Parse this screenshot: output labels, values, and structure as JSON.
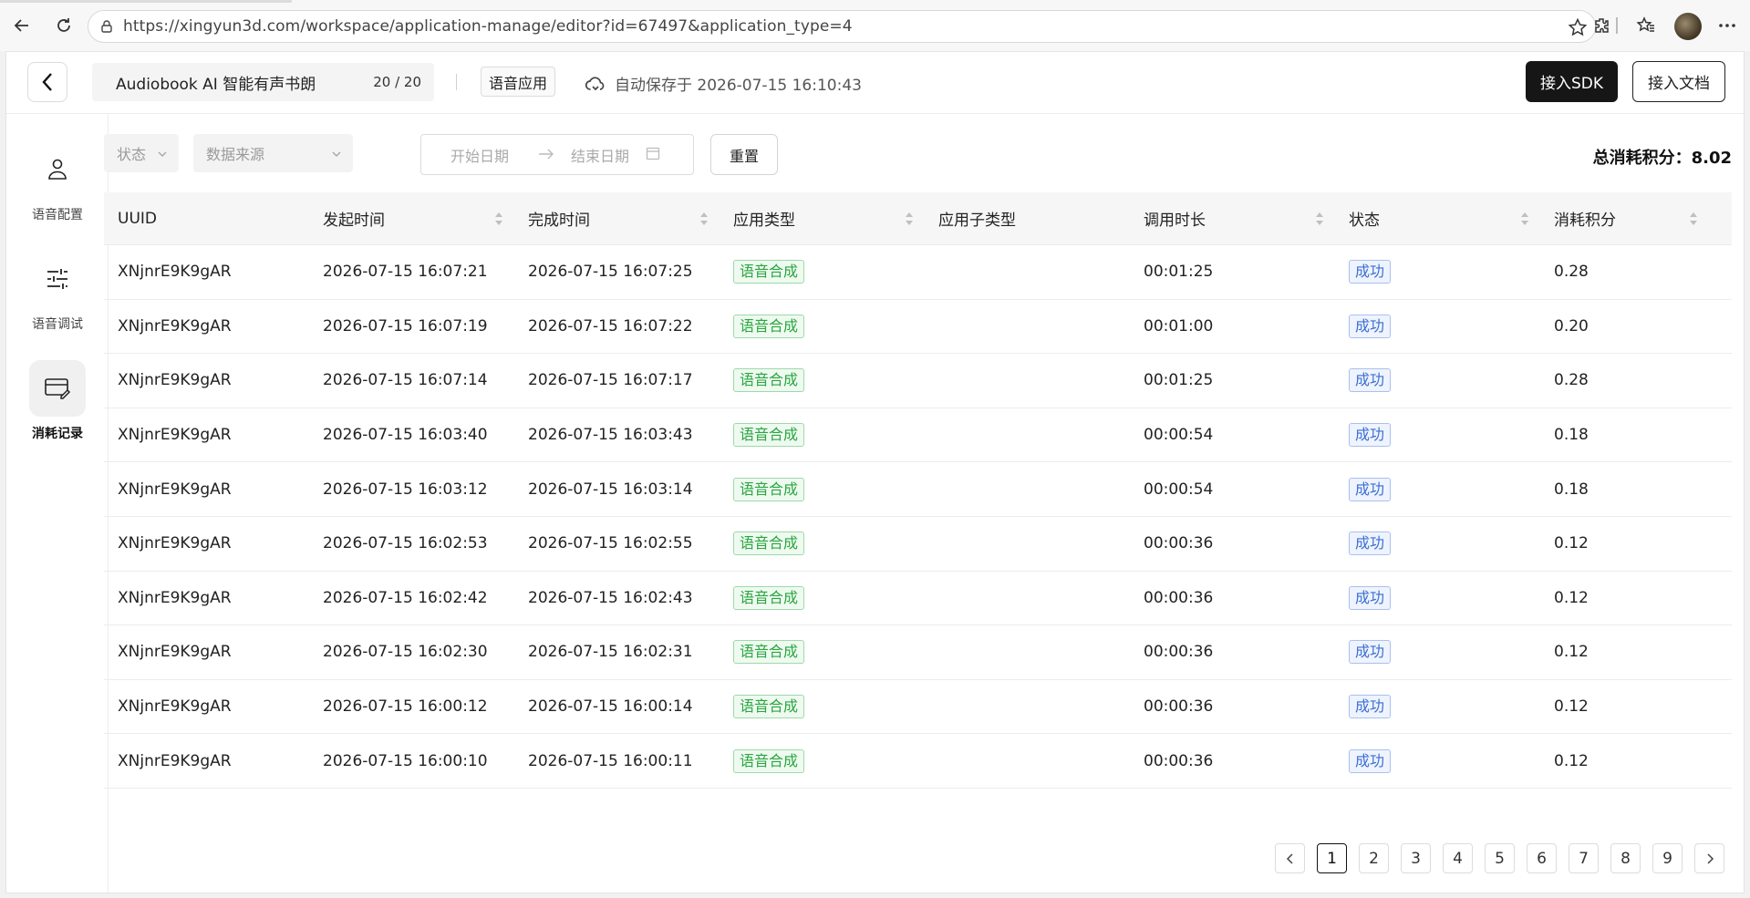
{
  "browser": {
    "url": "https://xingyun3d.com/workspace/application-manage/editor?id=67497&application_type=4"
  },
  "header": {
    "app_title": "Audiobook AI 智能有声书朗",
    "title_count": "20 / 20",
    "app_type": "语音应用",
    "autosave": "自动保存于 2026-07-15 16:10:43",
    "sdk_label": "接入SDK",
    "doc_label": "接入文档"
  },
  "sidebar": {
    "items": [
      {
        "label": "语音配置",
        "icon": "user-icon"
      },
      {
        "label": "语音调试",
        "icon": "sliders-icon"
      },
      {
        "label": "消耗记录",
        "icon": "card-edit-icon"
      }
    ]
  },
  "filters": {
    "status": "状态",
    "source": "数据来源",
    "start_date": "开始日期",
    "end_date": "结束日期",
    "reset": "重置"
  },
  "summary": {
    "total_points": "总消耗积分：8.02"
  },
  "table": {
    "headers": [
      "UUID",
      "发起时间",
      "完成时间",
      "应用类型",
      "应用子类型",
      "调用时长",
      "状态",
      "消耗积分"
    ],
    "rows": [
      {
        "uuid": "XNjnrE9K9gAR",
        "start": "2026-07-15 16:07:21",
        "end": "2026-07-15 16:07:25",
        "type": "语音合成",
        "subtype": "",
        "duration": "00:01:25",
        "status": "成功",
        "points": "0.28"
      },
      {
        "uuid": "XNjnrE9K9gAR",
        "start": "2026-07-15 16:07:19",
        "end": "2026-07-15 16:07:22",
        "type": "语音合成",
        "subtype": "",
        "duration": "00:01:00",
        "status": "成功",
        "points": "0.20"
      },
      {
        "uuid": "XNjnrE9K9gAR",
        "start": "2026-07-15 16:07:14",
        "end": "2026-07-15 16:07:17",
        "type": "语音合成",
        "subtype": "",
        "duration": "00:01:25",
        "status": "成功",
        "points": "0.28"
      },
      {
        "uuid": "XNjnrE9K9gAR",
        "start": "2026-07-15 16:03:40",
        "end": "2026-07-15 16:03:43",
        "type": "语音合成",
        "subtype": "",
        "duration": "00:00:54",
        "status": "成功",
        "points": "0.18"
      },
      {
        "uuid": "XNjnrE9K9gAR",
        "start": "2026-07-15 16:03:12",
        "end": "2026-07-15 16:03:14",
        "type": "语音合成",
        "subtype": "",
        "duration": "00:00:54",
        "status": "成功",
        "points": "0.18"
      },
      {
        "uuid": "XNjnrE9K9gAR",
        "start": "2026-07-15 16:02:53",
        "end": "2026-07-15 16:02:55",
        "type": "语音合成",
        "subtype": "",
        "duration": "00:00:36",
        "status": "成功",
        "points": "0.12"
      },
      {
        "uuid": "XNjnrE9K9gAR",
        "start": "2026-07-15 16:02:42",
        "end": "2026-07-15 16:02:43",
        "type": "语音合成",
        "subtype": "",
        "duration": "00:00:36",
        "status": "成功",
        "points": "0.12"
      },
      {
        "uuid": "XNjnrE9K9gAR",
        "start": "2026-07-15 16:02:30",
        "end": "2026-07-15 16:02:31",
        "type": "语音合成",
        "subtype": "",
        "duration": "00:00:36",
        "status": "成功",
        "points": "0.12"
      },
      {
        "uuid": "XNjnrE9K9gAR",
        "start": "2026-07-15 16:00:12",
        "end": "2026-07-15 16:00:14",
        "type": "语音合成",
        "subtype": "",
        "duration": "00:00:36",
        "status": "成功",
        "points": "0.12"
      },
      {
        "uuid": "XNjnrE9K9gAR",
        "start": "2026-07-15 16:00:10",
        "end": "2026-07-15 16:00:11",
        "type": "语音合成",
        "subtype": "",
        "duration": "00:00:36",
        "status": "成功",
        "points": "0.12"
      }
    ]
  },
  "pagination": {
    "pages": [
      "1",
      "2",
      "3",
      "4",
      "5",
      "6",
      "7",
      "8",
      "9"
    ],
    "current": "1"
  },
  "colors": {
    "accent_dark": "#161616",
    "tag_green": "#2aa63f",
    "tag_blue": "#3b6fd4"
  }
}
